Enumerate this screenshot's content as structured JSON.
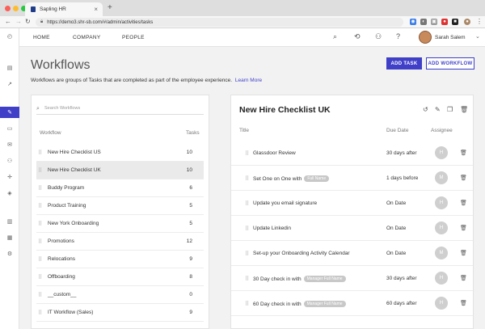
{
  "browser": {
    "tab_title": "Sapling HR",
    "url": "https://demo3.shr-sb.com/#/admin/activities/tasks"
  },
  "nav": {
    "home": "HOME",
    "company": "COMPANY",
    "people": "PEOPLE",
    "user_name": "Sarah Salem"
  },
  "page": {
    "title": "Workflows",
    "description": "Workflows are groups of Tasks that are completed as part of the employee experience.",
    "learn_more": "Learn More",
    "add_task": "ADD TASK",
    "add_workflow": "ADD WORKFLOW"
  },
  "workflows": {
    "search_placeholder": "Search Workflows",
    "col_workflow": "Workflow",
    "col_tasks": "Tasks",
    "selected_index": 1,
    "rows": [
      {
        "name": "New Hire Checklist US",
        "tasks": "10"
      },
      {
        "name": "New Hire Checklist UK",
        "tasks": "10"
      },
      {
        "name": "Buddy Program",
        "tasks": "6"
      },
      {
        "name": "Product Training",
        "tasks": "5"
      },
      {
        "name": "New York Onboarding",
        "tasks": "5"
      },
      {
        "name": "Promotions",
        "tasks": "12"
      },
      {
        "name": "Relocations",
        "tasks": "9"
      },
      {
        "name": "Offboarding",
        "tasks": "8"
      },
      {
        "name": "__custom__",
        "tasks": "0"
      },
      {
        "name": "IT Workflow (Sales)",
        "tasks": "9"
      }
    ]
  },
  "detail": {
    "title": "New Hire Checklist UK",
    "col_title": "Title",
    "col_due": "Due Date",
    "col_assignee": "Assignee",
    "tasks": [
      {
        "title": "Glassdoor Review",
        "pill": "",
        "due": "30 days after",
        "assignee": "H"
      },
      {
        "title": "Set One on One with",
        "pill": "Full Name",
        "due": "1 days before",
        "assignee": "M"
      },
      {
        "title": "Update you email signature",
        "pill": "",
        "due": "On Date",
        "assignee": "H"
      },
      {
        "title": "Update Linkedin",
        "pill": "",
        "due": "On Date",
        "assignee": "H"
      },
      {
        "title": "Set-up your Onboarding Activity Calendar",
        "pill": "",
        "due": "On Date",
        "assignee": "M"
      },
      {
        "title": "30 Day check in with",
        "pill": "Manager Full Name",
        "due": "30 days after",
        "assignee": "H"
      },
      {
        "title": "60 Day check in with",
        "pill": "Manager Full Name",
        "due": "60 days after",
        "assignee": "H"
      }
    ]
  },
  "colors": {
    "accent": "#3f3fc8",
    "background": "#f2f2f2"
  }
}
